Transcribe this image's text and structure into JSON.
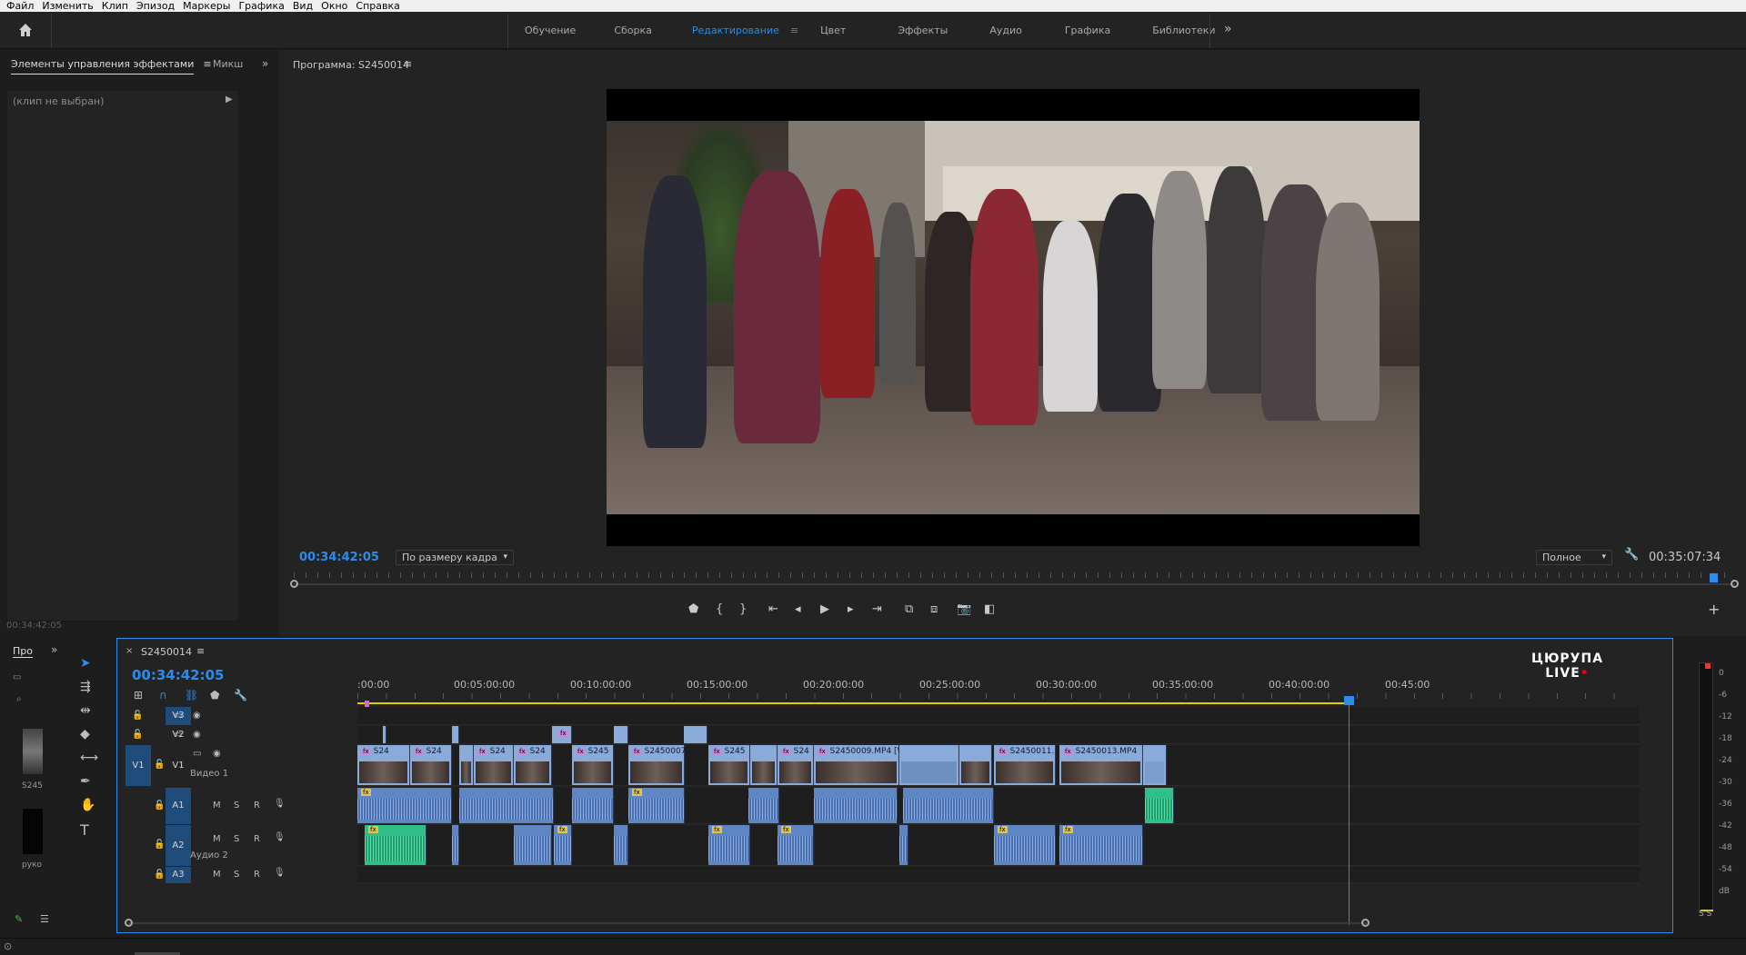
{
  "menu": [
    "Файл",
    "Изменить",
    "Клип",
    "Эпизод",
    "Маркеры",
    "Графика",
    "Вид",
    "Окно",
    "Справка"
  ],
  "workspace": {
    "tabs": [
      "Обучение",
      "Сборка",
      "Редактирование",
      "Цвет",
      "Эффекты",
      "Аудио",
      "Графика",
      "Библиотеки"
    ],
    "active": "Редактирование",
    "menu_icon": "≡",
    "more": "»"
  },
  "effects_panel": {
    "tab1": "Элементы управления эффектами",
    "tab1_menu": "≡",
    "tab2": "Микш",
    "more": "»",
    "no_clip": "(клип не выбран)",
    "timecode": "00:34:42:05"
  },
  "program": {
    "title": "Программа: S2450014",
    "menu": "≡",
    "timecode": "00:34:42:05",
    "fit": "По размеру кадра",
    "quality": "Полное",
    "duration": "00:35:07:34",
    "playhead_fraction": 0.988
  },
  "project_panel": {
    "tab": "Про",
    "more": "»",
    "label1": "S245",
    "label2": "руко"
  },
  "timeline": {
    "sequence": "S2450014",
    "menu": "≡",
    "timecode": "00:34:42:05",
    "logo_line1": "ЦЮРУПА",
    "logo_line2": "LIVE",
    "ruler": [
      ":00:00",
      "00:05:00:00",
      "00:10:00:00",
      "00:15:00:00",
      "00:20:00:00",
      "00:25:00:00",
      "00:30:00:00",
      "00:35:00:00",
      "00:40:00:00",
      "00:45:00"
    ],
    "tracks": {
      "v3": "V3",
      "v2": "V2",
      "v1": "V1",
      "v1_src": "V1",
      "v1_name": "Видео 1",
      "a1": "A1",
      "a2": "A2",
      "a2_name": "Аудио 2",
      "a3": "A3",
      "m": "M",
      "s": "S",
      "r": "R"
    },
    "v1_clip_labels": [
      "S24",
      "S24",
      "S24",
      "S24",
      "S245",
      "S2450007.",
      "S245",
      "S24",
      "S2450009.MP4 [V]",
      "S2450011.",
      "S2450013.MP4"
    ],
    "fx_badge": "fx"
  },
  "meter": {
    "labels": [
      "0",
      "-6",
      "-12",
      "-18",
      "-24",
      "-30",
      "-36",
      "-42",
      "-48",
      "-54",
      "dB"
    ],
    "solo": "S S"
  },
  "colors": {
    "accent": "#2d8ceb",
    "clip_video": "#8aaad9",
    "clip_audio": "#5f86c4",
    "clip_green": "#2fbf8a"
  }
}
